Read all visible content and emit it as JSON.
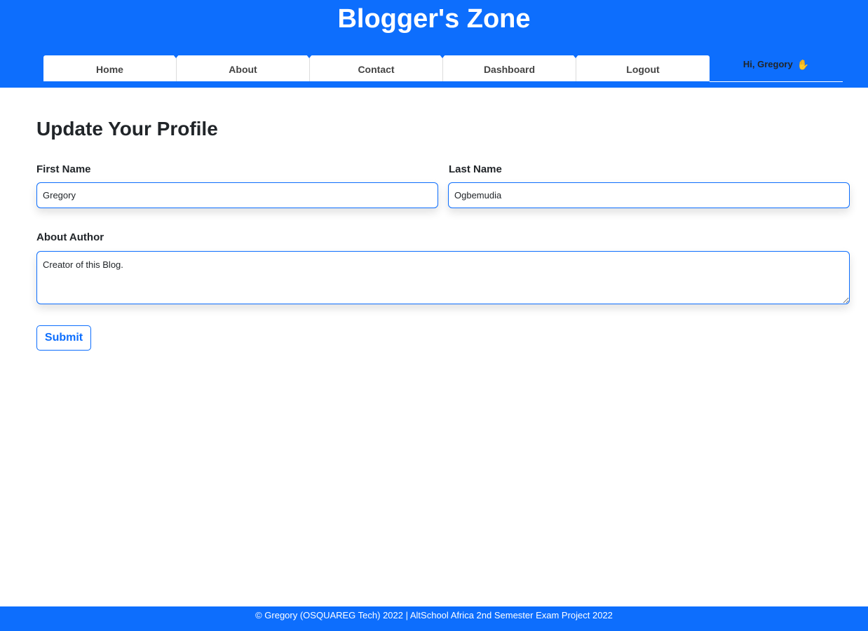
{
  "header": {
    "site_title": "Blogger's Zone",
    "nav": [
      {
        "label": "Home"
      },
      {
        "label": "About"
      },
      {
        "label": "Contact"
      },
      {
        "label": "Dashboard"
      },
      {
        "label": "Logout"
      }
    ],
    "greeting": "Hi, Gregory",
    "greeting_icon": "waving-hand-icon"
  },
  "form": {
    "title": "Update Your Profile",
    "first_name_label": "First Name",
    "first_name_value": "Gregory",
    "last_name_label": "Last Name",
    "last_name_value": "Ogbemudia",
    "about_label": "About Author",
    "about_value": "Creator of this Blog.",
    "submit_label": "Submit"
  },
  "footer": {
    "text": "© Gregory (OSQUAREG Tech) 2022 | AltSchool Africa 2nd Semester Exam Project 2022"
  },
  "colors": {
    "primary": "#0d6efd",
    "background": "#ffffff",
    "text": "#212529"
  }
}
